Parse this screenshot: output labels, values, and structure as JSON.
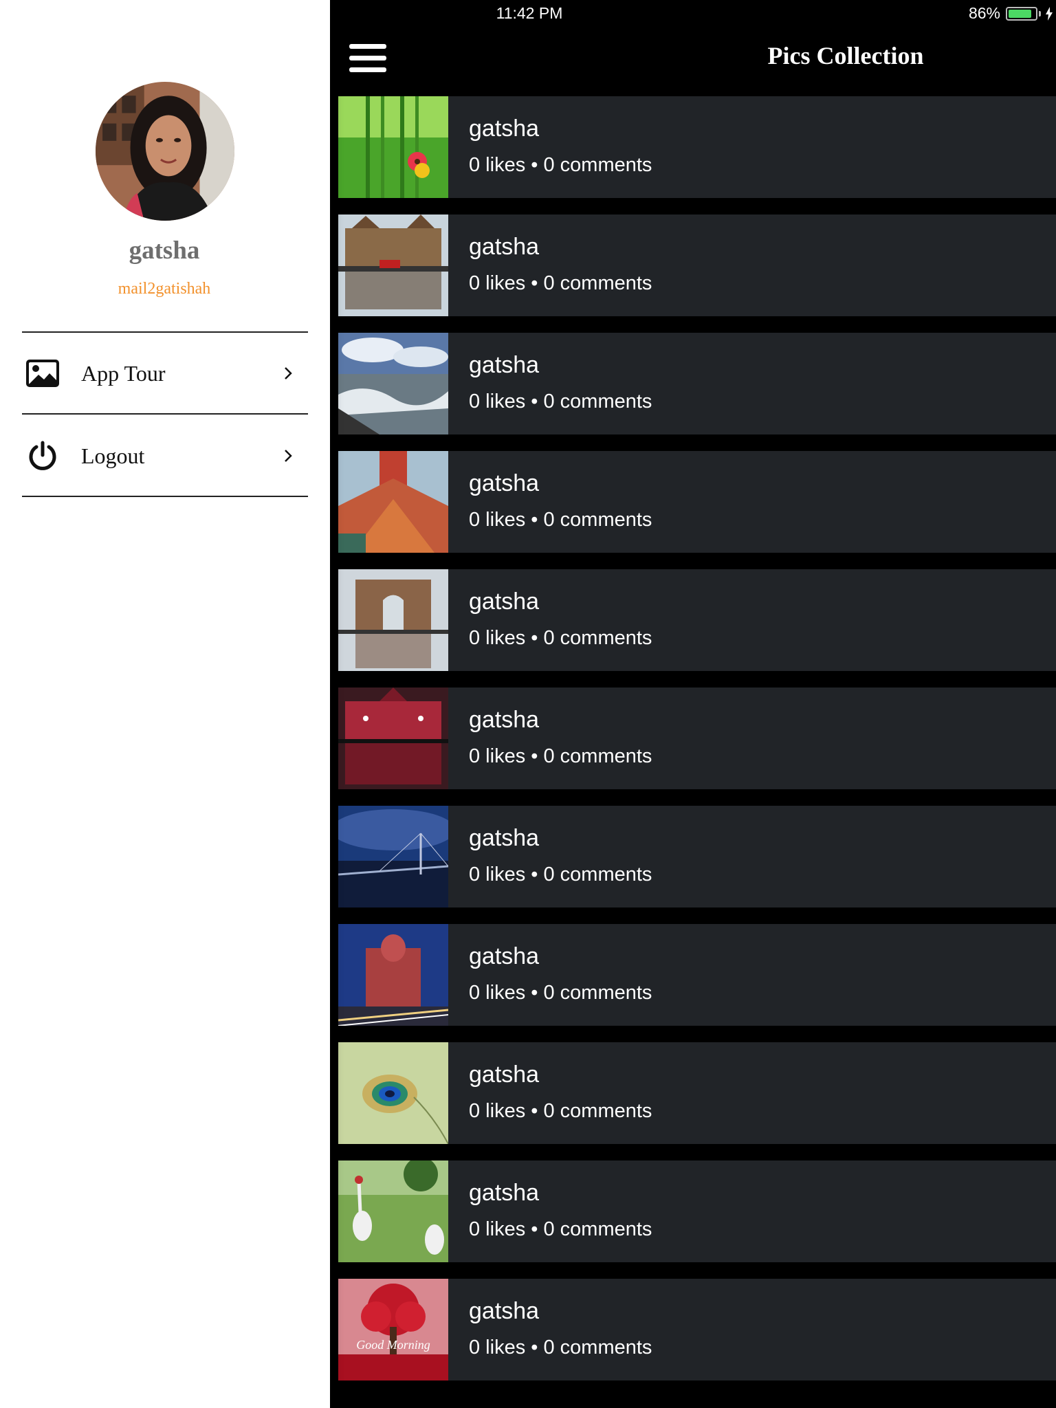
{
  "status_bar": {
    "time": "11:42 PM",
    "battery": "86%",
    "battery_level": 0.86
  },
  "nav": {
    "title": "Pics Collection",
    "menu_icon": "hamburger-icon"
  },
  "drawer": {
    "profile": {
      "name": "gatsha",
      "email": "mail2gatishah"
    },
    "items": [
      {
        "label": "App Tour",
        "icon": "image-icon"
      },
      {
        "label": "Logout",
        "icon": "power-icon"
      }
    ]
  },
  "feed": {
    "items": [
      {
        "author": "gatsha",
        "stats": "0 likes • 0 comments",
        "image": "bamboo-flower"
      },
      {
        "author": "gatsha",
        "stats": "0 likes • 0 comments",
        "image": "station-reflection"
      },
      {
        "author": "gatsha",
        "stats": "0 likes • 0 comments",
        "image": "sea-waves"
      },
      {
        "author": "gatsha",
        "stats": "0 likes • 0 comments",
        "image": "tower-roofs"
      },
      {
        "author": "gatsha",
        "stats": "0 likes • 0 comments",
        "image": "gateway-arch"
      },
      {
        "author": "gatsha",
        "stats": "0 likes • 0 comments",
        "image": "red-building"
      },
      {
        "author": "gatsha",
        "stats": "0 likes • 0 comments",
        "image": "sea-link-bridge"
      },
      {
        "author": "gatsha",
        "stats": "0 likes • 0 comments",
        "image": "night-building"
      },
      {
        "author": "gatsha",
        "stats": "0 likes • 0 comments",
        "image": "peacock-feather"
      },
      {
        "author": "gatsha",
        "stats": "0 likes • 0 comments",
        "image": "cranes"
      },
      {
        "author": "gatsha",
        "stats": "0 likes • 0 comments",
        "image": "red-tree"
      }
    ]
  }
}
